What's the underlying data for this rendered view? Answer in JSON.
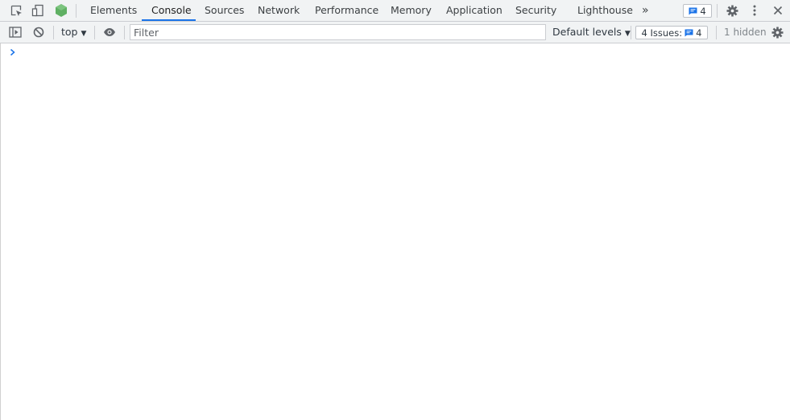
{
  "tabs": [
    {
      "label": "Elements",
      "active": false
    },
    {
      "label": "Console",
      "active": true
    },
    {
      "label": "Sources",
      "active": false
    },
    {
      "label": "Network",
      "active": false
    },
    {
      "label": "Performance",
      "active": false
    },
    {
      "label": "Memory",
      "active": false
    },
    {
      "label": "Application",
      "active": false
    },
    {
      "label": "Security",
      "active": false
    },
    {
      "label": "Lighthouse",
      "active": false
    }
  ],
  "more_tabs": "»",
  "messages_badge": {
    "count": "4",
    "icon": "message-icon"
  },
  "toolbar": {
    "context": "top",
    "filter_placeholder": "Filter",
    "levels": "Default levels",
    "issues_label": "4 Issues:",
    "issues_count": "4",
    "hidden": "1 hidden"
  },
  "colors": {
    "accent": "#1a73e8",
    "vue_green": "#4caf50"
  }
}
